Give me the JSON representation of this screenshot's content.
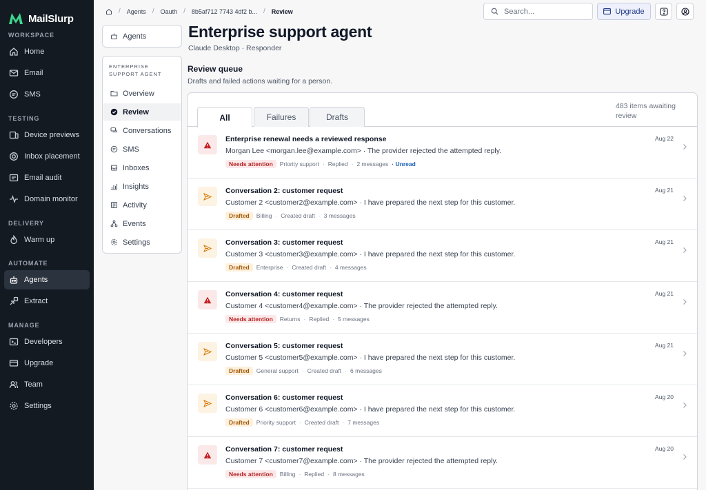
{
  "brand": {
    "name": "MailSlurp"
  },
  "sidebar": {
    "sections": [
      {
        "title": "WORKSPACE",
        "items": [
          {
            "label": "Home",
            "icon": "home-icon"
          },
          {
            "label": "Email",
            "icon": "mail-icon"
          },
          {
            "label": "SMS",
            "icon": "chat-icon"
          }
        ]
      },
      {
        "title": "TESTING",
        "items": [
          {
            "label": "Device previews",
            "icon": "devices-icon"
          },
          {
            "label": "Inbox placement",
            "icon": "target-icon"
          },
          {
            "label": "Email audit",
            "icon": "audit-icon"
          },
          {
            "label": "Domain monitor",
            "icon": "pulse-icon"
          }
        ]
      },
      {
        "title": "DELIVERY",
        "items": [
          {
            "label": "Warm up",
            "icon": "flame-icon"
          }
        ]
      },
      {
        "title": "AUTOMATE",
        "items": [
          {
            "label": "Agents",
            "icon": "robot-icon",
            "active": true
          },
          {
            "label": "Extract",
            "icon": "extract-icon"
          }
        ]
      },
      {
        "title": "MANAGE",
        "items": [
          {
            "label": "Developers",
            "icon": "terminal-icon"
          },
          {
            "label": "Upgrade",
            "icon": "card-icon"
          },
          {
            "label": "Team",
            "icon": "team-icon"
          },
          {
            "label": "Settings",
            "icon": "gear-icon"
          }
        ]
      }
    ]
  },
  "breadcrumb": {
    "items": [
      "Agents",
      "Oauth",
      "8b5af712 7743 4df2 b..."
    ],
    "current": "Review"
  },
  "topbar": {
    "search_placeholder": "Search...",
    "upgrade_label": "Upgrade"
  },
  "subnav": {
    "back_label": "Agents",
    "title_line1": "ENTERPRISE",
    "title_line2": "SUPPORT AGENT",
    "items": [
      {
        "label": "Overview",
        "icon": "folder-icon"
      },
      {
        "label": "Review",
        "icon": "check-circle-icon",
        "active": true
      },
      {
        "label": "Conversations",
        "icon": "conversations-icon"
      },
      {
        "label": "SMS",
        "icon": "sms-icon"
      },
      {
        "label": "Inboxes",
        "icon": "inbox-icon"
      },
      {
        "label": "Insights",
        "icon": "chart-icon"
      },
      {
        "label": "Activity",
        "icon": "activity-icon"
      },
      {
        "label": "Events",
        "icon": "events-icon"
      },
      {
        "label": "Settings",
        "icon": "gear-icon"
      }
    ]
  },
  "page": {
    "title": "Enterprise support agent",
    "subtitle": "Claude Desktop · Responder",
    "queue_title": "Review queue",
    "queue_desc": "Drafts and failed actions waiting for a person."
  },
  "tabs": [
    {
      "label": "All",
      "active": true
    },
    {
      "label": "Failures"
    },
    {
      "label": "Drafts"
    }
  ],
  "count_line1": "483 items awaiting",
  "count_line2": "review",
  "rows": [
    {
      "type": "fail",
      "title": "Enterprise renewal needs a reviewed response",
      "line": "Morgan Lee <morgan.lee@example.com> · The provider rejected the attempted reply.",
      "badge": "Needs attention",
      "tag": "Priority support",
      "state": "Replied",
      "messages": "2 messages",
      "unread": "Unread",
      "date": "Aug 22"
    },
    {
      "type": "draft",
      "title": "Conversation 2: customer request",
      "line": "Customer 2 <customer2@example.com> · I have prepared the next step for this customer.",
      "badge": "Drafted",
      "tag": "Billing",
      "state": "Created draft",
      "messages": "3 messages",
      "date": "Aug 21"
    },
    {
      "type": "draft",
      "title": "Conversation 3: customer request",
      "line": "Customer 3 <customer3@example.com> · I have prepared the next step for this customer.",
      "badge": "Drafted",
      "tag": "Enterprise",
      "state": "Created draft",
      "messages": "4 messages",
      "date": "Aug 21"
    },
    {
      "type": "fail",
      "title": "Conversation 4: customer request",
      "line": "Customer 4 <customer4@example.com> · The provider rejected the attempted reply.",
      "badge": "Needs attention",
      "tag": "Returns",
      "state": "Replied",
      "messages": "5 messages",
      "date": "Aug 21"
    },
    {
      "type": "draft",
      "title": "Conversation 5: customer request",
      "line": "Customer 5 <customer5@example.com> · I have prepared the next step for this customer.",
      "badge": "Drafted",
      "tag": "General support",
      "state": "Created draft",
      "messages": "6 messages",
      "date": "Aug 21"
    },
    {
      "type": "draft",
      "title": "Conversation 6: customer request",
      "line": "Customer 6 <customer6@example.com> · I have prepared the next step for this customer.",
      "badge": "Drafted",
      "tag": "Priority support",
      "state": "Created draft",
      "messages": "7 messages",
      "date": "Aug 20"
    },
    {
      "type": "fail",
      "title": "Conversation 7: customer request",
      "line": "Customer 7 <customer7@example.com> · The provider rejected the attempted reply.",
      "badge": "Needs attention",
      "tag": "Billing",
      "state": "Replied",
      "messages": "8 messages",
      "date": "Aug 20"
    }
  ]
}
